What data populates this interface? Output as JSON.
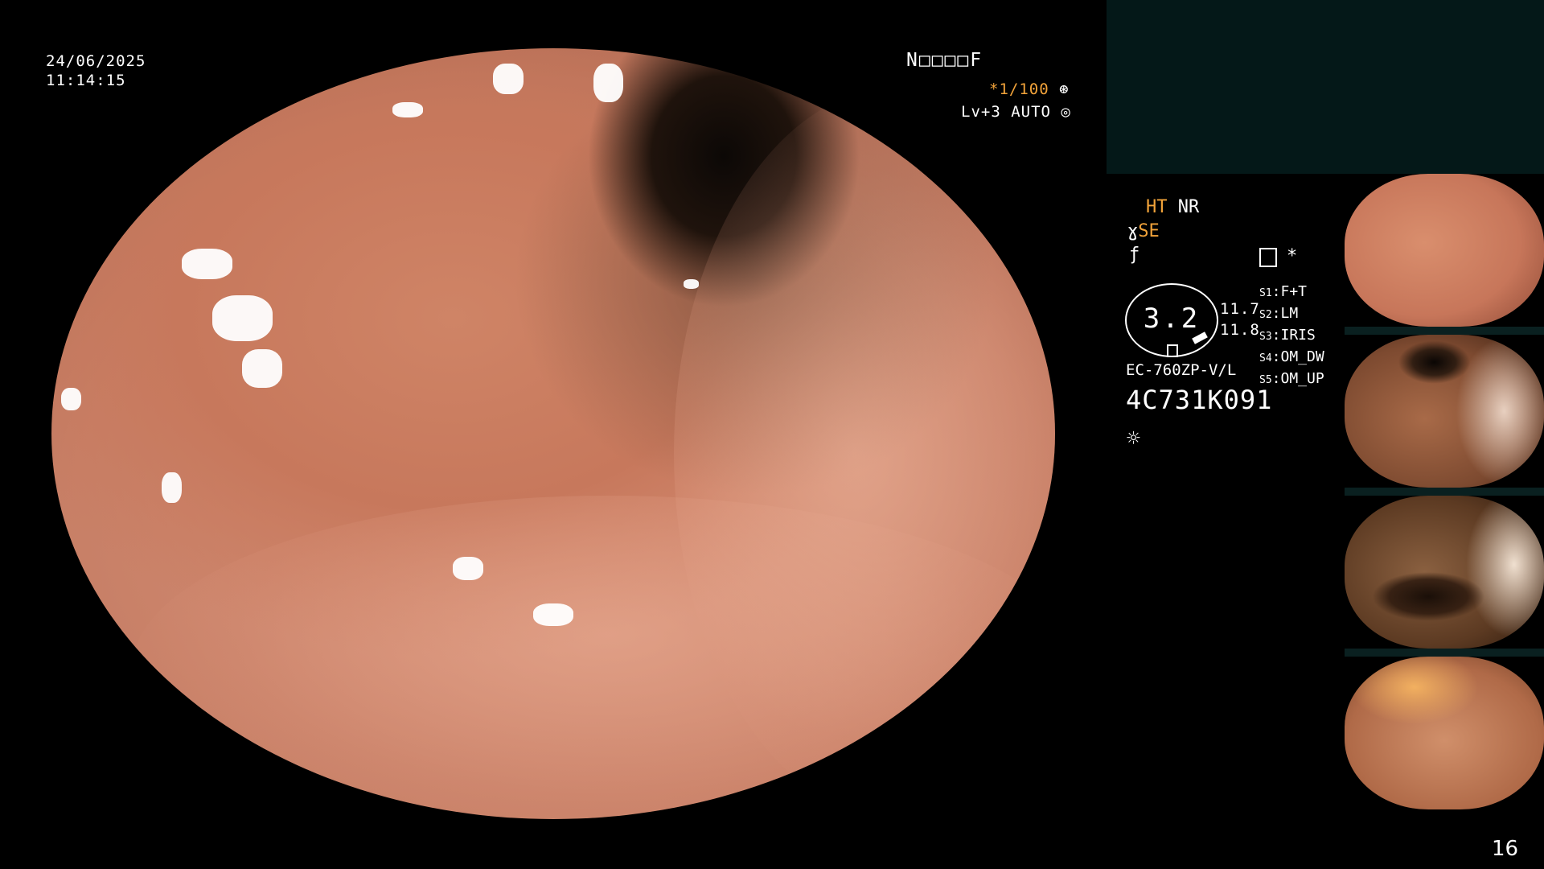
{
  "datetime": {
    "date": "24/06/2025",
    "time": "11:14:15"
  },
  "status_top": {
    "patient_code": "N□□□□F",
    "shutter": "*1/100",
    "level": "Lv+3 AUTO"
  },
  "enhance": {
    "ht": "HT",
    "nr": "NR",
    "se": "SE"
  },
  "menu_icons": {
    "memo": "memo-icon",
    "asterisk": "*"
  },
  "gauge": {
    "value": "3.2",
    "right_top": "11.7",
    "right_bottom": "11.8"
  },
  "switches": [
    {
      "key": "S1",
      "value": "F+T"
    },
    {
      "key": "S2",
      "value": "LM"
    },
    {
      "key": "S3",
      "value": "IRIS"
    },
    {
      "key": "S4",
      "value": "OM_DW"
    },
    {
      "key": "S5",
      "value": "OM_UP"
    }
  ],
  "scope": {
    "model": "EC-760ZP-V/L",
    "serial": "4C731K091"
  },
  "page_number": "16"
}
